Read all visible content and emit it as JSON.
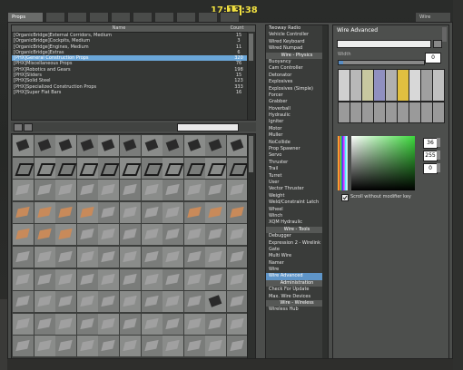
{
  "clock": {
    "pre": "17:",
    "hour": "13",
    "post": ":38"
  },
  "tabs": [
    {
      "label": "Props",
      "active": true
    },
    {
      "label": "",
      "active": false
    },
    {
      "label": "",
      "active": false
    },
    {
      "label": "",
      "active": false
    },
    {
      "label": "",
      "active": false
    },
    {
      "label": "",
      "active": false
    },
    {
      "label": "",
      "active": false
    },
    {
      "label": "",
      "active": false
    },
    {
      "label": "",
      "active": false
    },
    {
      "label": "",
      "active": false
    },
    {
      "label": "Wire",
      "active": false
    }
  ],
  "prop_list": {
    "header_name": "Name",
    "header_count": "Count",
    "rows": [
      {
        "name": "[OrganicBridge]External Corridors, Medium",
        "count": "15",
        "selected": false
      },
      {
        "name": "[OrganicBridge]Cockpits, Medium",
        "count": "3",
        "selected": false
      },
      {
        "name": "[OrganicBridge]Engines, Medium",
        "count": "11",
        "selected": false
      },
      {
        "name": "[OrganicBridge]Extras",
        "count": "6",
        "selected": false
      },
      {
        "name": "[PHX]General Construction Props",
        "count": "320",
        "selected": true
      },
      {
        "name": "[PHX]Miscellaneous Props",
        "count": "76",
        "selected": false
      },
      {
        "name": "[PHX]Robotics and Gears",
        "count": "198",
        "selected": false
      },
      {
        "name": "[PHX]Sliders",
        "count": "15",
        "selected": false
      },
      {
        "name": "[PHX]Solid Steel",
        "count": "123",
        "selected": false
      },
      {
        "name": "[PHX]Specialized Construction Props",
        "count": "333",
        "selected": false
      },
      {
        "name": "[PHX]Super Flat Bars",
        "count": "16",
        "selected": false
      }
    ]
  },
  "tool_list": [
    {
      "label": "Twoway Radio",
      "type": "item"
    },
    {
      "label": "Vehicle Controller",
      "type": "item"
    },
    {
      "label": "Wired Keyboard",
      "type": "item"
    },
    {
      "label": "Wired Numpad",
      "type": "item"
    },
    {
      "label": "Wire - Physics",
      "type": "header"
    },
    {
      "label": "Buoyancy",
      "type": "item"
    },
    {
      "label": "Cam Controller",
      "type": "item"
    },
    {
      "label": "Detonator",
      "type": "item"
    },
    {
      "label": "Explosives",
      "type": "item"
    },
    {
      "label": "Explosives (Simple)",
      "type": "item"
    },
    {
      "label": "Forcer",
      "type": "item"
    },
    {
      "label": "Grabber",
      "type": "item"
    },
    {
      "label": "Hoverball",
      "type": "item"
    },
    {
      "label": "Hydraulic",
      "type": "item"
    },
    {
      "label": "Igniter",
      "type": "item"
    },
    {
      "label": "Motor",
      "type": "item"
    },
    {
      "label": "Muller",
      "type": "item"
    },
    {
      "label": "NoCollide",
      "type": "item"
    },
    {
      "label": "Prop Spawner",
      "type": "item"
    },
    {
      "label": "Servo",
      "type": "item"
    },
    {
      "label": "Thruster",
      "type": "item"
    },
    {
      "label": "Trail",
      "type": "item"
    },
    {
      "label": "Turret",
      "type": "item"
    },
    {
      "label": "User",
      "type": "item"
    },
    {
      "label": "Vector Thruster",
      "type": "item"
    },
    {
      "label": "Weight",
      "type": "item"
    },
    {
      "label": "Weld/Constraint Latch",
      "type": "item"
    },
    {
      "label": "Wheel",
      "type": "item"
    },
    {
      "label": "Winch",
      "type": "item"
    },
    {
      "label": "XQM Hydraulic",
      "type": "item"
    },
    {
      "label": "Wire - Tools",
      "type": "header"
    },
    {
      "label": "Debugger",
      "type": "item"
    },
    {
      "label": "Expression 2 - Wirelink",
      "type": "item"
    },
    {
      "label": "Gate",
      "type": "item"
    },
    {
      "label": "Multi Wire",
      "type": "item"
    },
    {
      "label": "Namer",
      "type": "item"
    },
    {
      "label": "Wire",
      "type": "item"
    },
    {
      "label": "Wire Advanced",
      "type": "selected"
    },
    {
      "label": "Administration",
      "type": "header"
    },
    {
      "label": "Check For Update",
      "type": "item"
    },
    {
      "label": "Max. Wire Devices",
      "type": "item"
    },
    {
      "label": "Wire - Wireless",
      "type": "header"
    },
    {
      "label": "Wireless Hub",
      "type": "item"
    }
  ],
  "wire_panel": {
    "title": "Wire Advanced",
    "width_label": "Width",
    "width_value": "0",
    "width_fraction": 0.05,
    "rgb": {
      "r": "36",
      "g": "255",
      "b": "0"
    },
    "checkbox_label": "Scroll without modifier key",
    "checkbox_checked": true
  },
  "colors": {
    "accent": "#6aa6d8",
    "clock": "#f0e040"
  }
}
